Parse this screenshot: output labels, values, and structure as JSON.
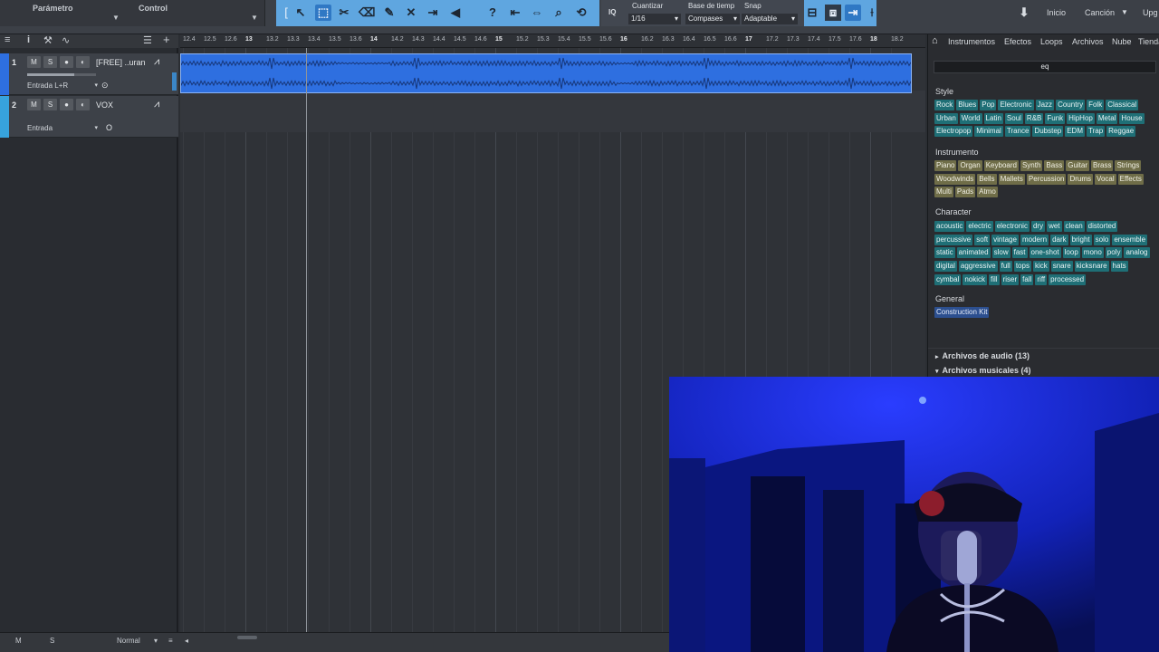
{
  "toolbar": {
    "param_label": "Parámetro",
    "control_label": "Control",
    "quantize_label": "Cuantizar",
    "quantize_value": "1/16",
    "timebase_label": "Base de tiemp",
    "timebase_value": "Compases",
    "snap_label": "Snap",
    "snap_value": "Adaptable",
    "iq_label": "IQ",
    "start_label": "Inicio",
    "song_label": "Canción",
    "upgrade_label": "Upg"
  },
  "ruler": {
    "ticks": [
      "12.4",
      "12.5",
      "12.6",
      "13",
      "13.2",
      "13.3",
      "13.4",
      "13.5",
      "13.6",
      "14",
      "14.2",
      "14.3",
      "14.4",
      "14.5",
      "14.6",
      "15",
      "15.2",
      "15.3",
      "15.4",
      "15.5",
      "15.6",
      "16",
      "16.2",
      "16.3",
      "16.4",
      "16.5",
      "16.6",
      "17",
      "17.2",
      "17.3",
      "17.4",
      "17.5",
      "17.6",
      "18",
      "18.2"
    ]
  },
  "tracks": [
    {
      "number": "1",
      "name": "[FREE] ..uran",
      "input": "Entrada L+R",
      "color": "#2e6fe0",
      "mute": "M",
      "solo": "S"
    },
    {
      "number": "2",
      "name": "VOX",
      "input": "Entrada",
      "color": "#37a3dc",
      "mute": "M",
      "solo": "S"
    }
  ],
  "bottom": {
    "m_label": "M",
    "s_label": "S",
    "mode_label": "Normal"
  },
  "browser": {
    "tabs": [
      "Instrumentos",
      "Efectos",
      "Loops",
      "Archivos",
      "Nube",
      "Tienda"
    ],
    "search_value": "eq",
    "sections": {
      "style": "Style",
      "instrument": "Instrumento",
      "character": "Character",
      "general": "General"
    },
    "style_tags": [
      [
        "Rock",
        "Blues",
        "Pop",
        "Electronic",
        "Jazz",
        "Country",
        "Folk",
        "Classical"
      ],
      [
        "Urban",
        "World",
        "Latin",
        "Soul",
        "R&B",
        "Funk",
        "HipHop",
        "Metal",
        "House"
      ],
      [
        "Electropop",
        "Minimal",
        "Trance",
        "Dubstep",
        "EDM",
        "Trap",
        "Reggae"
      ]
    ],
    "instrument_tags": [
      [
        "Piano",
        "Organ",
        "Keyboard",
        "Synth",
        "Bass",
        "Guitar",
        "Brass",
        "Strings"
      ],
      [
        "Woodwinds",
        "Bells",
        "Mallets",
        "Percussion",
        "Drums",
        "Vocal",
        "Effects"
      ],
      [
        "Multi",
        "Pads",
        "Atmo"
      ]
    ],
    "character_tags": [
      [
        "acoustic",
        "electric",
        "electronic",
        "dry",
        "wet",
        "clean",
        "distorted"
      ],
      [
        "percussive",
        "soft",
        "vintage",
        "modern",
        "dark",
        "bright",
        "solo",
        "ensemble"
      ],
      [
        "static",
        "animated",
        "slow",
        "fast",
        "one-shot",
        "loop",
        "mono",
        "poly",
        "analog"
      ],
      [
        "digital",
        "aggressive",
        "full",
        "tops",
        "kick",
        "snare",
        "kicksnare",
        "hats"
      ],
      [
        "cymbal",
        "nokick",
        "fill",
        "riser",
        "fall",
        "riff",
        "processed"
      ]
    ],
    "general_tags": [
      "Construction Kit"
    ],
    "folders": [
      "Archivos de audio (13)",
      "Archivos musicales (4)"
    ]
  },
  "colors": {
    "clip": "#2e6fe0",
    "tool_accent": "#5fa6e0",
    "tag_teal": "#1f6f76",
    "tag_olive": "#6f6d48"
  }
}
